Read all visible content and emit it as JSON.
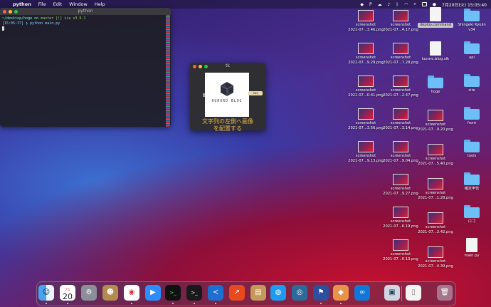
{
  "menubar": {
    "apple": "",
    "items": [
      "python",
      "File",
      "Edit",
      "Window",
      "Help"
    ],
    "datetime": "7月20日(火) 15:05:40"
  },
  "terminal": {
    "title": "python",
    "line1_path": "~/desktop/hoge on",
    "line1_branch": "master [!] via",
    "line1_ver": "v3.9.1",
    "line2": "[15:05:37] ❯ python main.py"
  },
  "tk": {
    "title": "tk",
    "logo_text": "KURORO BLOG",
    "button_label": "aaa",
    "label": "文字列の左側へ画像\nを配置する"
  },
  "desktop": {
    "col1": [
      {
        "name": "screenshot",
        "sub": "2021-07...3.46.png"
      },
      {
        "name": "screenshot",
        "sub": "2021-07...9.29.png"
      },
      {
        "name": "screenshot",
        "sub": "2021-07...0.41.png"
      },
      {
        "name": "screenshot",
        "sub": "2021-07...3.56.png"
      },
      {
        "name": "screenshot",
        "sub": "2021-07...9.13.png"
      }
    ],
    "col2": [
      {
        "name": "screenshot",
        "sub": "2021-07...4.17.png"
      },
      {
        "name": "screenshot",
        "sub": "2021-07...7.28.png"
      },
      {
        "name": "screenshot",
        "sub": "2021-07...2.47.png"
      },
      {
        "name": "screenshot",
        "sub": "2021-07...3.14.png"
      },
      {
        "name": "screenshot",
        "sub": "2021-07...9.04.png"
      },
      {
        "name": "screenshot",
        "sub": "2021-07...9.27.png"
      },
      {
        "name": "screenshot",
        "sub": "2021-07...6.19.png"
      },
      {
        "name": "screenshot",
        "sub": "2021-07...0.13.png"
      }
    ],
    "col3": [
      {
        "name": "deploy.command",
        "sub": "",
        "kind": "doc",
        "selected": true
      },
      {
        "name": "kuroro.blog.slk",
        "sub": "",
        "kind": "doc"
      },
      {
        "name": "hoge",
        "sub": "",
        "kind": "folder"
      },
      {
        "name": "screenshot",
        "sub": "2021-07...9.20.png"
      },
      {
        "name": "screenshot",
        "sub": "2021-07...5.40.png"
      },
      {
        "name": "screenshot",
        "sub": "2021-07...1.28.png"
      },
      {
        "name": "screenshot",
        "sub": "2021-07...3.42.png"
      },
      {
        "name": "screenshot",
        "sub": "2021-07...4.39.png"
      }
    ],
    "col4": [
      {
        "name": "Shingeki Kyojin",
        "sub": "v34",
        "kind": "folder"
      },
      {
        "name": "api",
        "sub": "",
        "kind": "folder"
      },
      {
        "name": "site",
        "sub": "",
        "kind": "folder"
      },
      {
        "name": "front",
        "sub": "",
        "kind": "folder"
      },
      {
        "name": "tools",
        "sub": "",
        "kind": "folder"
      },
      {
        "name": "確定申告",
        "sub": "",
        "kind": "folder"
      },
      {
        "name": "ロゴ",
        "sub": "",
        "kind": "folder"
      },
      {
        "name": "main.py",
        "sub": "",
        "kind": "doc"
      }
    ]
  },
  "dock": {
    "calendar_month": "7月",
    "calendar_day": "20",
    "apps": [
      "finder",
      "calendar",
      "system-preferences",
      "contacts",
      "chrome",
      "zoom",
      "terminal-green",
      "terminal",
      "vscode",
      "activity",
      "archive",
      "docker",
      "proxyman",
      "sourcetree",
      "preview",
      "infinity"
    ]
  }
}
